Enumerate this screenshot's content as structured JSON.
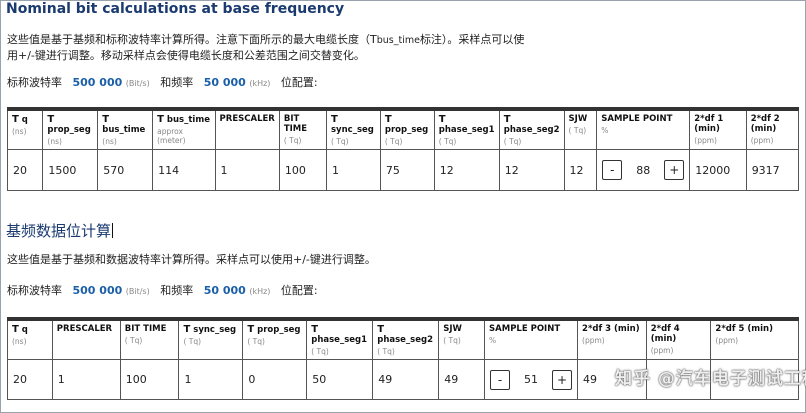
{
  "section1": {
    "title": "Nominal bit calculations at base frequency",
    "desc_a": "这些值是基于基频和标称波特率计算所得。注意下面所示的最大电缆长度（T",
    "desc_sub": "bus_time",
    "desc_b": "标注）。采样点可以使",
    "desc_c": "用+/-键进行调整。移动采样点会使得电缆长度和公差范围之间交替变化。",
    "rate_label": "标称波特率",
    "rate_value": "500 000",
    "rate_unit": "(Bit/s)",
    "freq_label": "和频率",
    "freq_value": "50 000",
    "freq_unit": "(kHz)",
    "rate_suffix": "位配置:",
    "headers": [
      {
        "t": "T",
        "name": "q",
        "unit": "(ns)"
      },
      {
        "t": "T",
        "name": "prop_seg",
        "unit": "(ns)"
      },
      {
        "t": "T",
        "name": "bus_time",
        "unit": "(ns)"
      },
      {
        "t": "T",
        "name": "bus_time",
        "unit": "approx (meter)"
      },
      {
        "t": "",
        "name": "PRESCALER",
        "unit": ""
      },
      {
        "t": "",
        "name": "BIT TIME",
        "unit": "( Tq)"
      },
      {
        "t": "T",
        "name": "sync_seg",
        "unit": "( Tq)"
      },
      {
        "t": "T",
        "name": "prop_seg",
        "unit": "( Tq)"
      },
      {
        "t": "T",
        "name": "phase_seg1",
        "unit": "( Tq)"
      },
      {
        "t": "T",
        "name": "phase_seg2",
        "unit": "( Tq)"
      },
      {
        "t": "",
        "name": "SJW",
        "unit": "( Tq)"
      },
      {
        "t": "",
        "name": "SAMPLE POINT",
        "unit": "%"
      },
      {
        "t": "",
        "name": "2*df 1 (min)",
        "unit": "(ppm)"
      },
      {
        "t": "",
        "name": "2*df 2 (min)",
        "unit": "(ppm)"
      }
    ],
    "row": [
      "20",
      "1500",
      "570",
      "114",
      "1",
      "100",
      "1",
      "75",
      "12",
      "12",
      "12",
      "88",
      "12000",
      "9317"
    ],
    "minus": "-",
    "plus": "+"
  },
  "section2": {
    "title": "基频数据位计算",
    "desc": "这些值是基于基频和数据波特率计算所得。采样点可以使用+/-键进行调整。",
    "rate_label": "标称波特率",
    "rate_value": "500 000",
    "rate_unit": "(Bit/s)",
    "freq_label": "和频率",
    "freq_value": "50 000",
    "freq_unit": "(kHz)",
    "rate_suffix": "位配置:",
    "headers": [
      {
        "t": "T",
        "name": "q",
        "unit": "(ns)"
      },
      {
        "t": "",
        "name": "PRESCALER",
        "unit": ""
      },
      {
        "t": "",
        "name": "BIT TIME",
        "unit": "( Tq)"
      },
      {
        "t": "T",
        "name": "sync_seg",
        "unit": "( Tq)"
      },
      {
        "t": "T",
        "name": "prop_seg",
        "unit": "( Tq)"
      },
      {
        "t": "T",
        "name": "phase_seg1",
        "unit": "( Tq)"
      },
      {
        "t": "T",
        "name": "phase_seg2",
        "unit": "( Tq)"
      },
      {
        "t": "",
        "name": "SJW",
        "unit": "( Tq)"
      },
      {
        "t": "",
        "name": "SAMPLE POINT",
        "unit": "%"
      },
      {
        "t": "",
        "name": "2*df 3 (min)",
        "unit": "(ppm)"
      },
      {
        "t": "",
        "name": "2*df 4 (min)",
        "unit": "(ppm)"
      },
      {
        "t": "",
        "name": "2*df 5 (min)",
        "unit": "(ppm)"
      }
    ],
    "row": [
      "20",
      "1",
      "100",
      "1",
      "0",
      "50",
      "49",
      "49",
      "51",
      "49",
      "",
      ""
    ],
    "minus": "-",
    "plus": "+"
  },
  "watermark": "知乎 @汽车电子测试工程师"
}
